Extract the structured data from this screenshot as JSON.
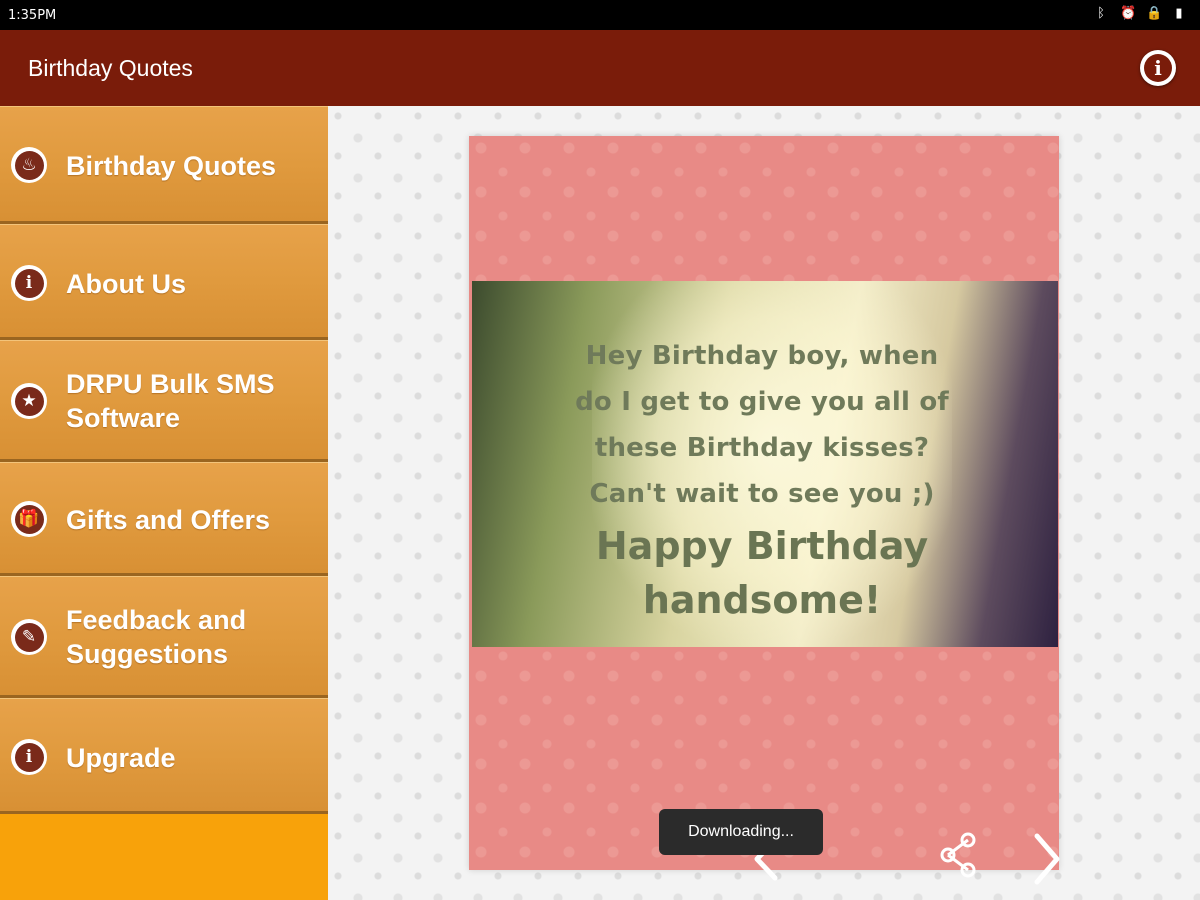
{
  "status_bar": {
    "time": "1:35PM",
    "icons": [
      "bluetooth-icon",
      "alarm-icon",
      "lock-icon",
      "battery-icon"
    ]
  },
  "app_bar": {
    "title": "Birthday Quotes",
    "info_icon": "info-icon",
    "color": "#7a1c0a"
  },
  "sidebar": {
    "items": [
      {
        "label": "Birthday Quotes",
        "icon": "cake-icon"
      },
      {
        "label": "About Us",
        "icon": "info-icon"
      },
      {
        "label": "DRPU Bulk SMS Software",
        "icon": "star-icon"
      },
      {
        "label": "Gifts and Offers",
        "icon": "gift-icon"
      },
      {
        "label": "Feedback and Suggestions",
        "icon": "feedback-icon"
      },
      {
        "label": "Upgrade",
        "icon": "info-icon"
      }
    ],
    "accent": "#f8a20a"
  },
  "card": {
    "quote": "Hey Birthday boy, when do I get to give you all of these Birthday kisses? Can't wait to see you ;)",
    "headline": "Happy Birthday handsome!",
    "quote_lines": [
      "Hey Birthday boy, when",
      "do I get to give you all of",
      "these Birthday kisses?",
      "Can't wait to see you ;)"
    ],
    "headline_lines": [
      "Happy Birthday",
      "handsome!"
    ],
    "background": "#e88a86"
  },
  "toast": {
    "text": "Downloading..."
  },
  "controls": {
    "prev_icon": "chevron-left-icon",
    "share_icon": "share-icon",
    "next_icon": "chevron-right-icon"
  }
}
